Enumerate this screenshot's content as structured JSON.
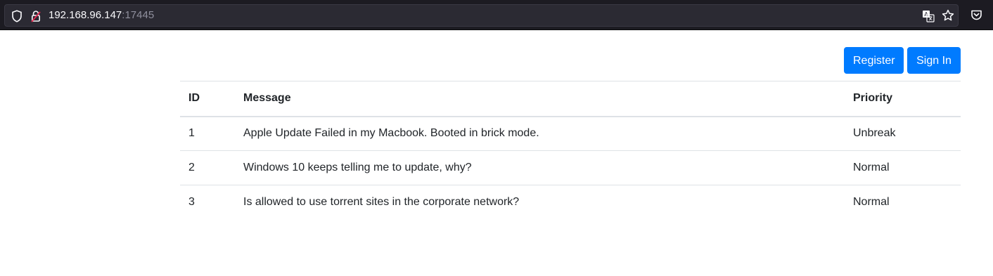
{
  "browser": {
    "url_host": "192.168.96.147",
    "url_port": ":17445",
    "icons": {
      "shield": "shield-icon",
      "lock": "insecure-lock-icon",
      "translate": "translate-icon",
      "bookmark": "star-icon",
      "pocket": "pocket-icon"
    }
  },
  "auth": {
    "register_label": "Register",
    "signin_label": "Sign In"
  },
  "table": {
    "headers": {
      "id": "ID",
      "message": "Message",
      "priority": "Priority"
    },
    "rows": [
      {
        "id": "1",
        "message": "Apple Update Failed in my Macbook. Booted in brick mode.",
        "priority": "Unbreak"
      },
      {
        "id": "2",
        "message": "Windows 10 keeps telling me to update, why?",
        "priority": "Normal"
      },
      {
        "id": "3",
        "message": "Is allowed to use torrent sites in the corporate network?",
        "priority": "Normal"
      }
    ]
  },
  "colors": {
    "primary": "#007bff",
    "browser_bg": "#1c1b22",
    "urlbar_bg": "#2b2a33",
    "table_border": "#dee2e6",
    "text": "#212529"
  }
}
